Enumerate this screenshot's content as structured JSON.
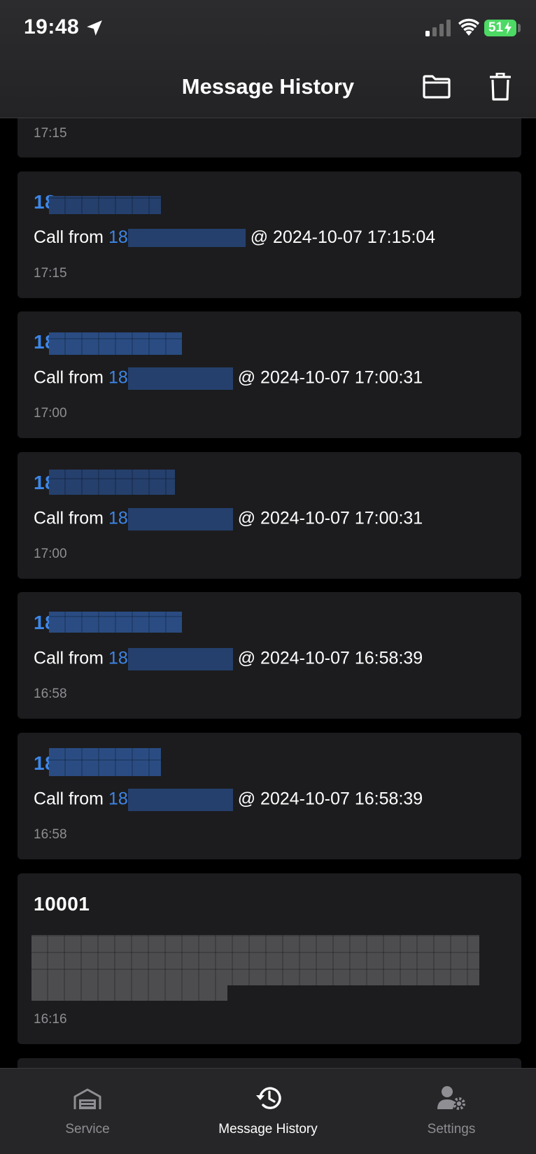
{
  "status_bar": {
    "time": "19:48",
    "battery": "51"
  },
  "header": {
    "title": "Message History"
  },
  "messages": [
    {
      "time": "17:15"
    },
    {
      "sender_prefix": "18",
      "body_prefix": "Call from ",
      "body_number_prefix": "18",
      "body_suffix": " @ 2024-10-07 17:15:04",
      "time": "17:15"
    },
    {
      "sender_prefix": "18",
      "body_prefix": "Call from ",
      "body_number_prefix": "18",
      "body_suffix": " @ 2024-10-07 17:00:31",
      "time": "17:00"
    },
    {
      "sender_prefix": "18",
      "body_prefix": "Call from ",
      "body_number_prefix": "18",
      "body_suffix": " @ 2024-10-07 17:00:31",
      "time": "17:00"
    },
    {
      "sender_prefix": "18",
      "body_prefix": "Call from ",
      "body_number_prefix": "18",
      "body_suffix": " @ 2024-10-07 16:58:39",
      "time": "16:58"
    },
    {
      "sender_prefix": "18",
      "body_prefix": "Call from ",
      "body_number_prefix": "18",
      "body_suffix": " @ 2024-10-07 16:58:39",
      "time": "16:58"
    },
    {
      "sender": "10001",
      "time": "16:16"
    }
  ],
  "tabbar": {
    "tabs": [
      {
        "label": "Service",
        "icon": "garage-icon",
        "active": false
      },
      {
        "label": "Message History",
        "icon": "history-icon",
        "active": true
      },
      {
        "label": "Settings",
        "icon": "user-settings-icon",
        "active": false
      }
    ]
  },
  "colors": {
    "accent_blue": "#3d86e8",
    "card_bg": "#1c1c1e",
    "muted_text": "#8e8e93",
    "inactive_tab": "#8e8e93",
    "battery_green": "#4cd964"
  }
}
